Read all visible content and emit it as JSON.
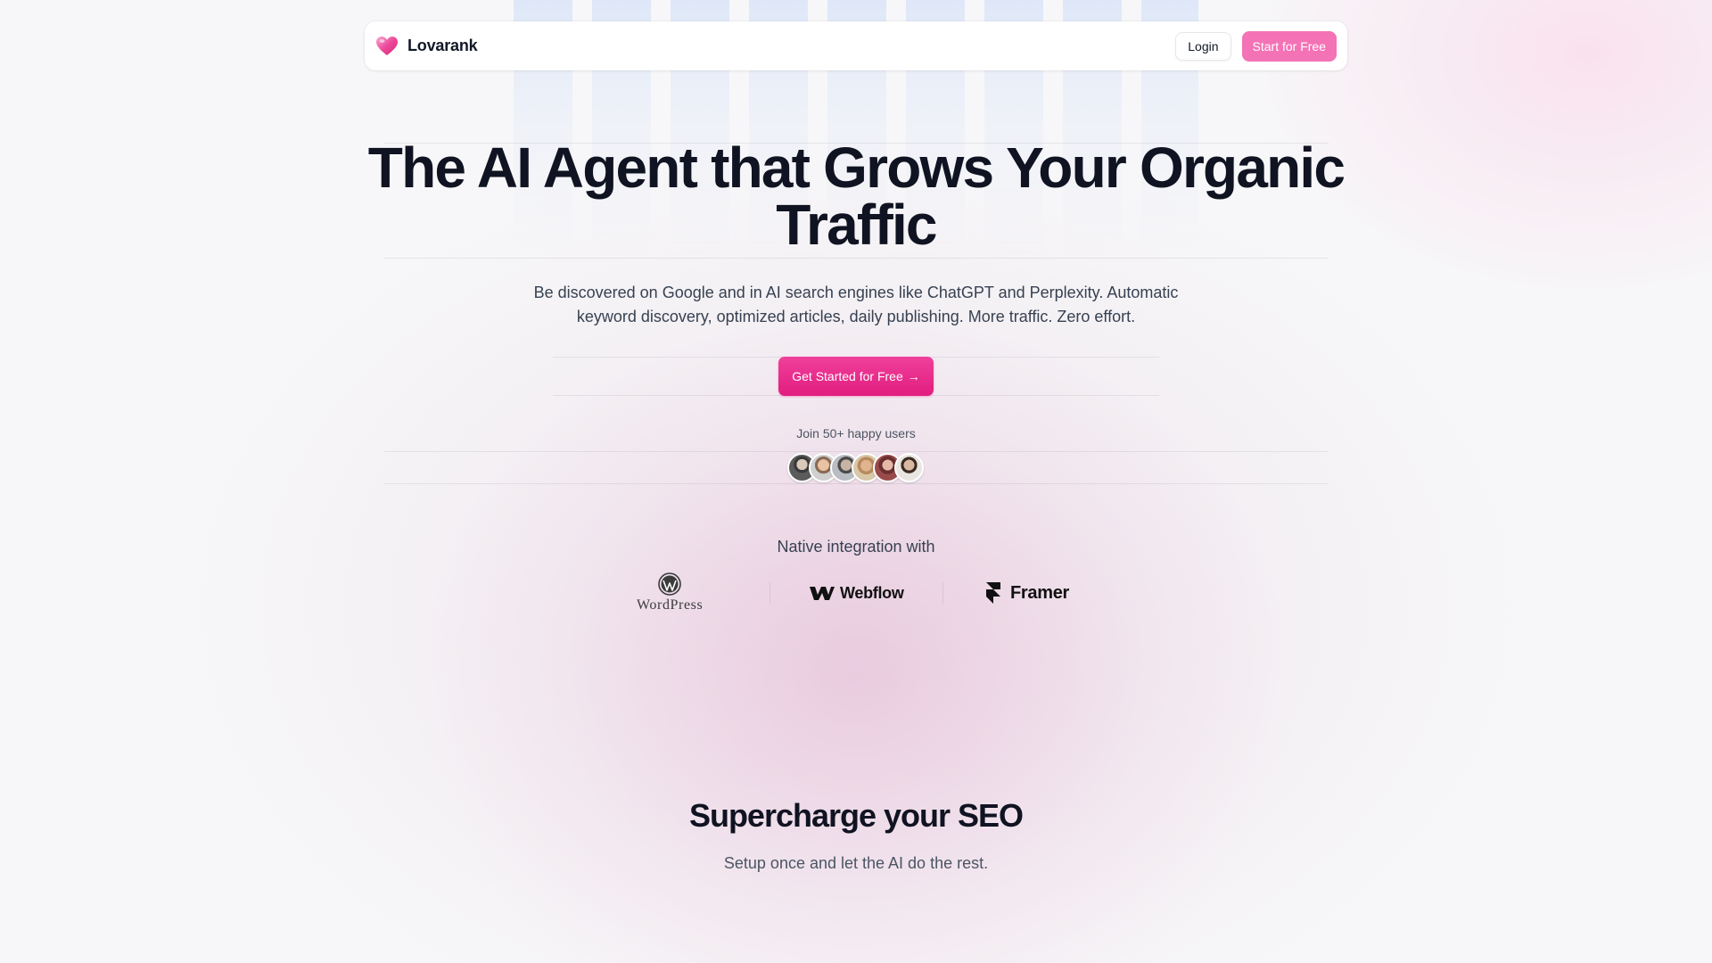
{
  "navbar": {
    "brand": "Lovarank",
    "login_label": "Login",
    "start_label": "Start for Free"
  },
  "hero": {
    "title_line1": "The AI Agent that Grows Your Organic",
    "title_line2": "Traffic",
    "subtitle_line1": "Be discovered on Google and in AI search engines like ChatGPT and Perplexity. Automatic",
    "subtitle_line2": "keyword discovery, optimized articles, daily publishing. More traffic. Zero effort.",
    "cta_label": "Get Started for Free",
    "cta_arrow": "→",
    "join_text": "Join 50+ happy users"
  },
  "integrations": {
    "label": "Native integration with",
    "items": [
      {
        "name": "WordPress",
        "icon": "wordpress-logo"
      },
      {
        "name": "Webflow",
        "icon": "webflow-logo"
      },
      {
        "name": "Framer",
        "icon": "framer-logo"
      }
    ]
  },
  "section": {
    "title": "Supercharge your SEO",
    "subtitle": "Setup once and let the AI do the rest."
  },
  "colors": {
    "accent": "#e11d7f",
    "nav_button": "#f472b6",
    "text": "#101321"
  }
}
